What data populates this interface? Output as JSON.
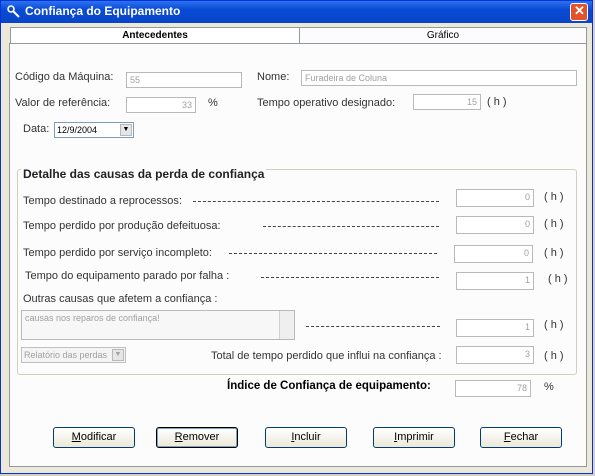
{
  "window": {
    "title": "Confiança do Equipamento"
  },
  "tabs": [
    {
      "label": "Antecedentes"
    },
    {
      "label": "Gráfico"
    }
  ],
  "fields": {
    "codigo_label": "Código da Máquina:",
    "codigo_value": "55",
    "nome_label": "Nome:",
    "nome_value": "Furadeira de Coluna",
    "valor_label": "Valor de referência:",
    "valor_value": "33",
    "valor_unit": "%",
    "tempo_op_label": "Tempo operativo designado:",
    "tempo_op_value": "15",
    "tempo_op_unit": "( h )",
    "data_label": "Data:",
    "data_value": "12/9/2004"
  },
  "group": {
    "title": "Detalhe das causas da perda de confiança",
    "rows": [
      {
        "label": "Tempo destinado a reprocessos:",
        "value": "0",
        "unit": "( h )"
      },
      {
        "label": "Tempo perdido por produção defeituosa:",
        "value": "0",
        "unit": "( h )"
      },
      {
        "label": "Tempo perdido por serviço incompleto:",
        "value": "0",
        "unit": "( h )"
      },
      {
        "label": "Tempo do equipamento parado  por falha :",
        "value": "1",
        "unit": "( h )"
      }
    ],
    "outras_label": "Outras causas que afetem a confiança :",
    "outras_text": "causas nos reparos de confiança!",
    "outras_value": "1",
    "outras_unit": "( h )",
    "relatorio_value": "Relatório das perdas",
    "total_label": "Total de tempo perdido que influi na confiança :",
    "total_value": "3",
    "total_unit": "( h )"
  },
  "indice": {
    "label": "Índice de Confiança de equipamento:",
    "value": "78",
    "unit": "%"
  },
  "buttons": {
    "modificar": {
      "pre": "",
      "key": "M",
      "post": "odificar"
    },
    "remover": {
      "pre": "",
      "key": "R",
      "post": "emover"
    },
    "incluir": {
      "pre": "",
      "key": "I",
      "post": "ncluir"
    },
    "imprimir": {
      "pre": "",
      "key": "I",
      "post": "mprimir"
    },
    "fechar": {
      "pre": "",
      "key": "F",
      "post": "echar"
    }
  },
  "colors": {
    "titlebar": "#0a4ad4",
    "close": "#e0532c",
    "window": "#ece9d8"
  }
}
